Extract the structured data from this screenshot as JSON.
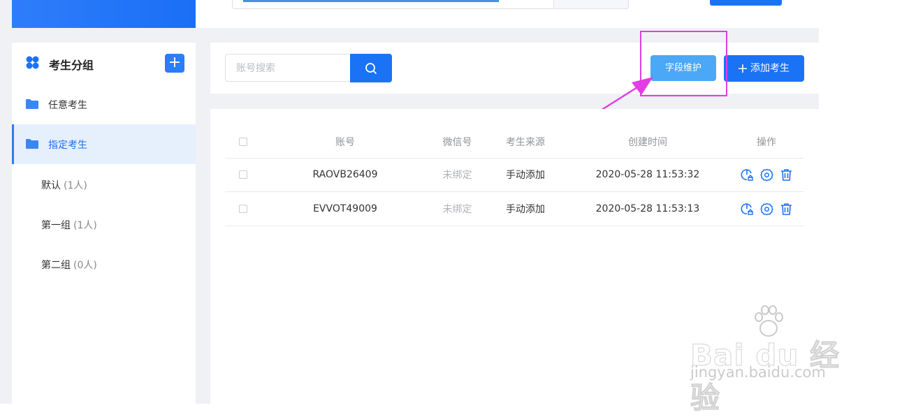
{
  "sidebar": {
    "title": "考生分组",
    "add_label": "+",
    "items": [
      {
        "label": "任意考生"
      },
      {
        "label": "指定考生"
      }
    ],
    "groups": [
      {
        "name": "默认",
        "count": "(1人)"
      },
      {
        "name": "第一组",
        "count": "(1人)"
      },
      {
        "name": "第二组",
        "count": "(0人)"
      }
    ]
  },
  "toolbar": {
    "search_placeholder": "账号搜索",
    "field_button": "字段维护",
    "add_button": "添加考生"
  },
  "table": {
    "headers": [
      "账号",
      "微信号",
      "考生来源",
      "创建时间",
      "操作"
    ],
    "rows": [
      {
        "account": "RAOVB26409",
        "wechat": "未绑定",
        "source": "手动添加",
        "created": "2020-05-28 11:53:32"
      },
      {
        "account": "EVVOT49009",
        "wechat": "未绑定",
        "source": "手动添加",
        "created": "2020-05-28 11:53:13"
      }
    ]
  },
  "watermark": {
    "brand": "Bai du 经验",
    "url": "jingyan.baidu.com"
  },
  "colors": {
    "primary": "#1a73f5",
    "light_button": "#4ba8f6",
    "highlight": "#e13ee3",
    "active_bg": "#e6f0fd"
  },
  "icons": [
    "search-icon",
    "folder-icon",
    "clover-icon",
    "plus-icon",
    "edit-icon",
    "settings-icon",
    "delete-icon",
    "paw-icon"
  ]
}
